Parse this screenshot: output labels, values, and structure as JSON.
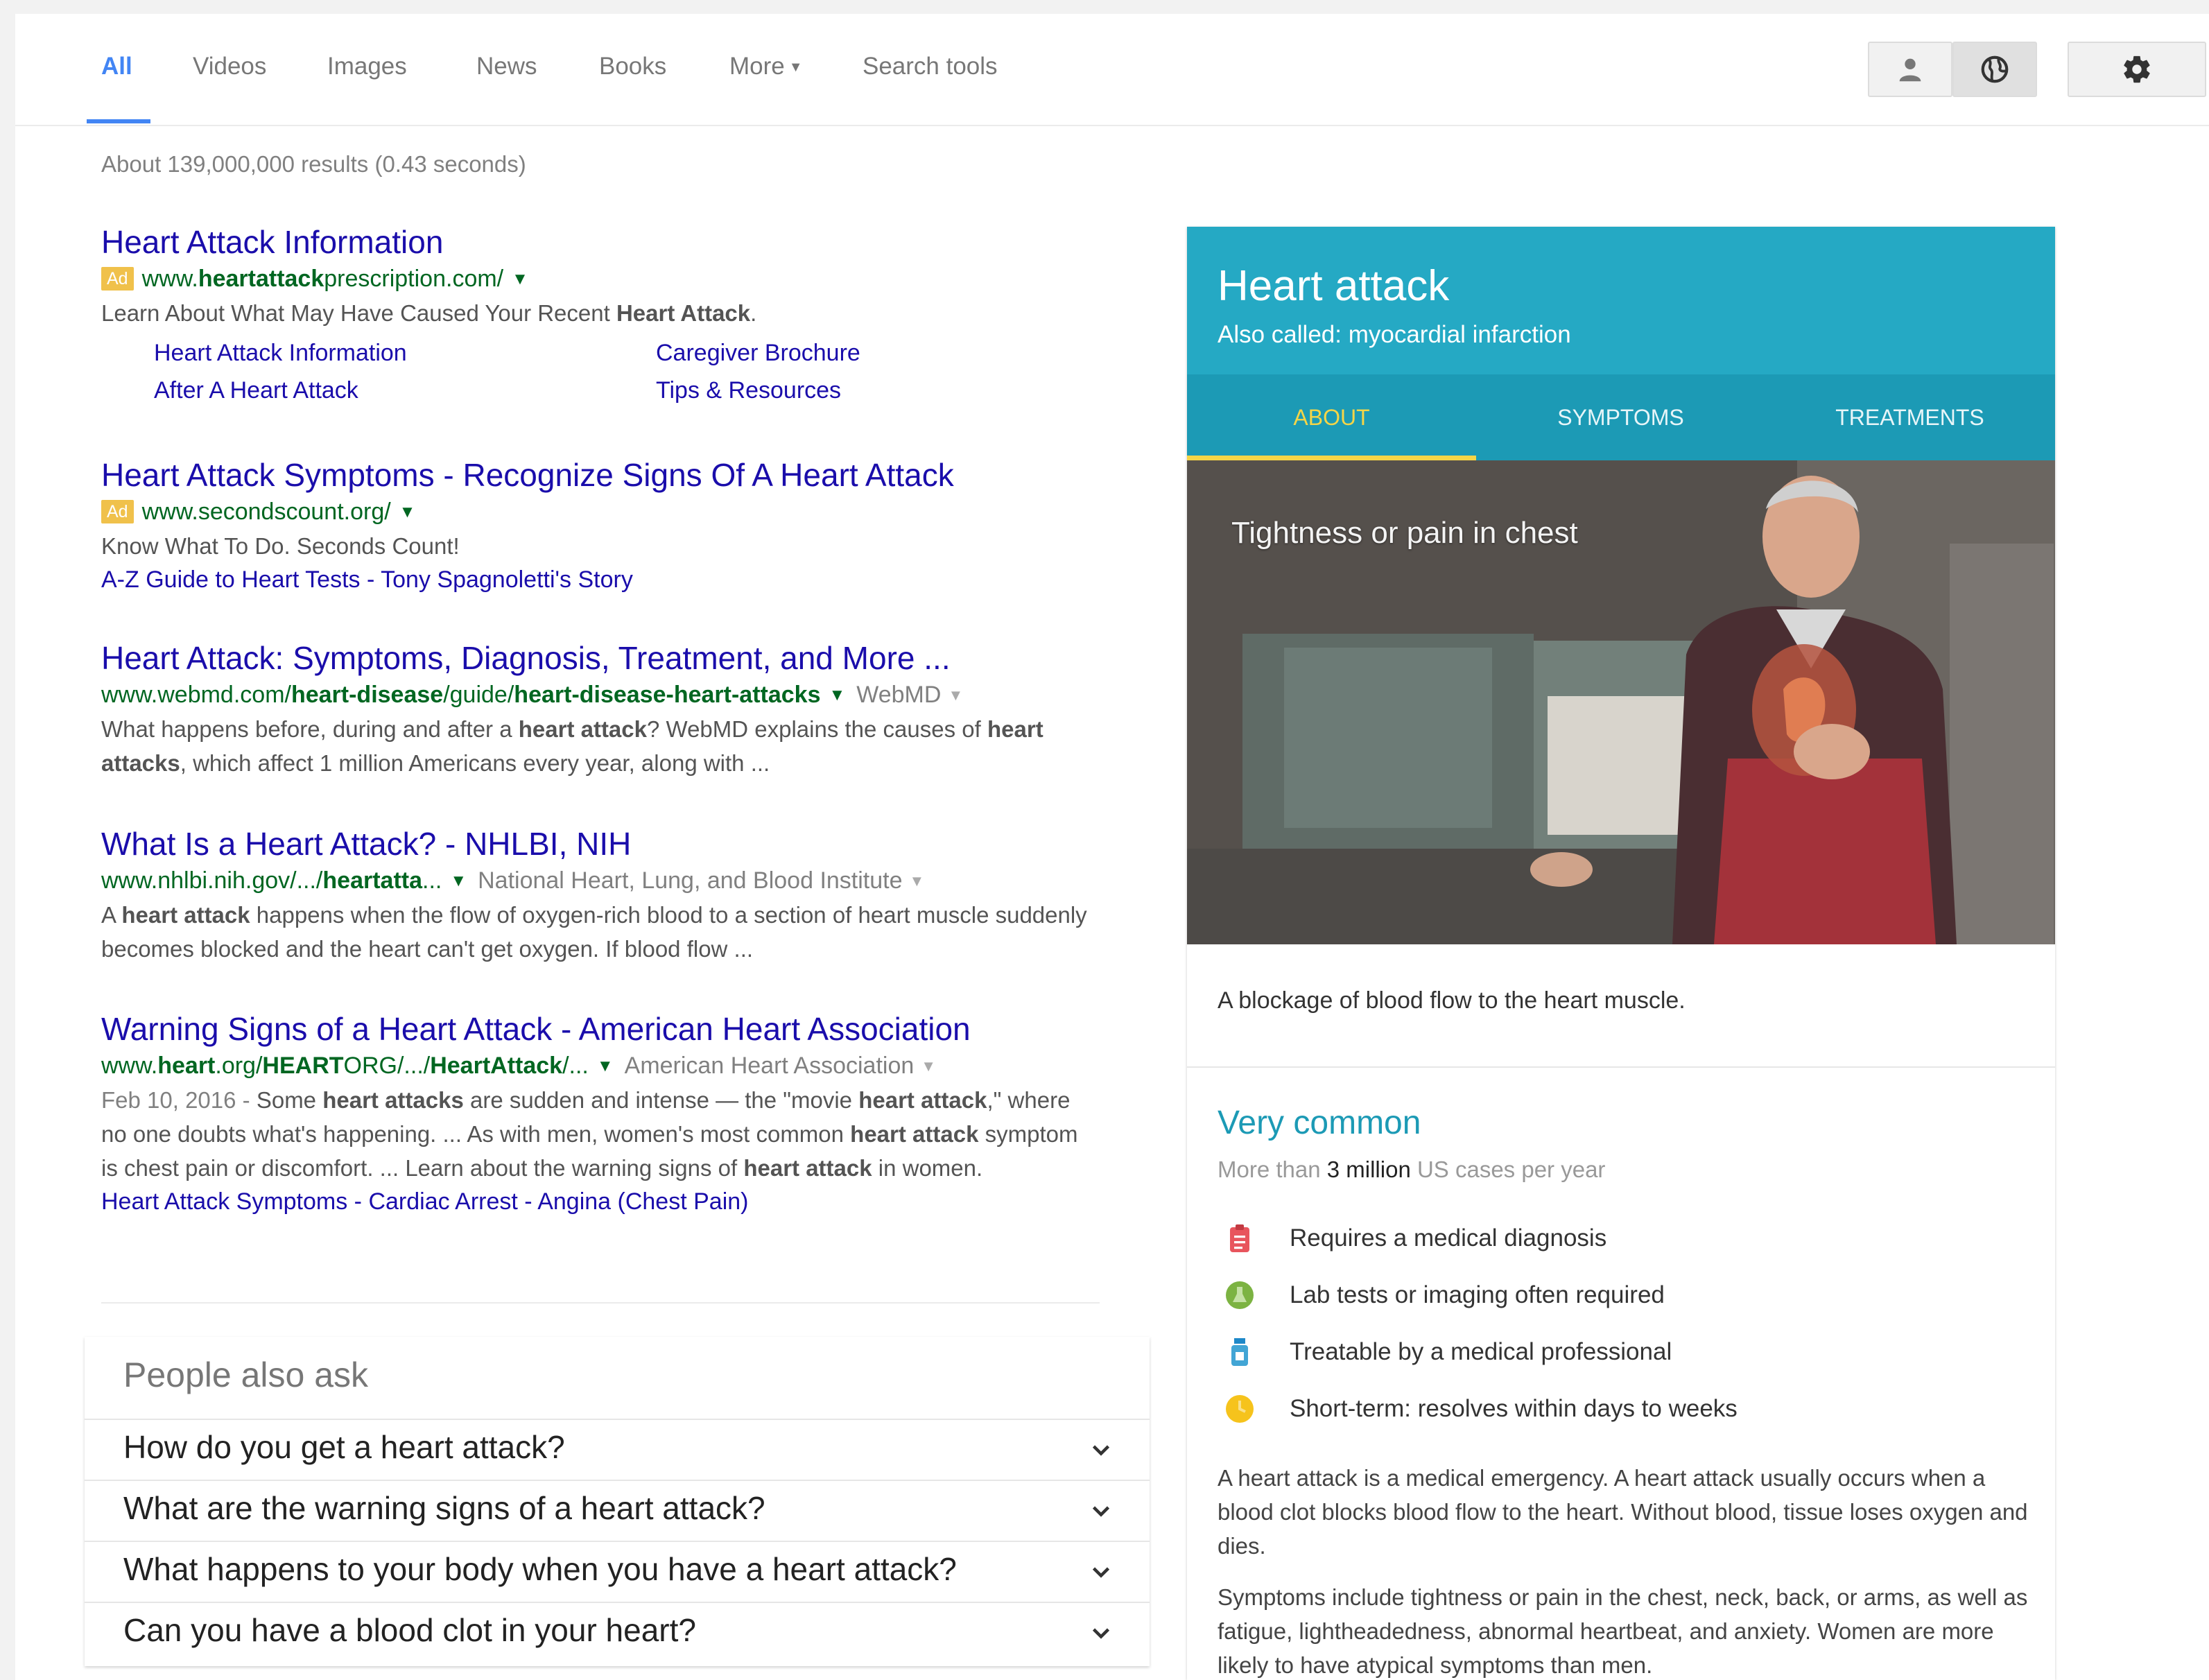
{
  "nav": {
    "tabs": [
      "All",
      "Videos",
      "Images",
      "News",
      "Books",
      "More",
      "Search tools"
    ],
    "active_tab": "All"
  },
  "result_stats": "About 139,000,000 results (0.43 seconds)",
  "results": [
    {
      "title": "Heart Attack Information",
      "ad_label": "Ad",
      "url_pre": "www.",
      "url_bold": "heartattack",
      "url_post": "prescription.com/",
      "snippet_pre": "Learn About What May Have Caused Your Recent ",
      "snippet_bold": "Heart Attack",
      "snippet_post": ".",
      "sitelinks": [
        "Heart Attack Information",
        "After A Heart Attack",
        "Caregiver Brochure",
        "Tips & Resources"
      ]
    },
    {
      "title": "Heart Attack Symptoms - Recognize Signs Of A Heart Attack",
      "ad_label": "Ad",
      "url": "www.secondscount.org/",
      "snippet": "Know What To Do. Seconds Count!",
      "links": [
        "A-Z Guide to Heart Tests",
        "Tony Spagnoletti's Story"
      ]
    },
    {
      "title": "Heart Attack: Symptoms, Diagnosis, Treatment, and More ...",
      "url_parts": [
        "www.webmd.com/",
        "heart-disease",
        "/guide/",
        "heart-disease-heart-attacks"
      ],
      "source": "WebMD",
      "snippet_parts": [
        "What happens before, during and after a ",
        "heart attack",
        "? WebMD explains the causes of ",
        "heart attacks",
        ", which affect 1 million Americans every year, along with ..."
      ]
    },
    {
      "title": "What Is a Heart Attack? - NHLBI, NIH",
      "url_parts": [
        "www.nhlbi.nih.gov/.../",
        "heartatta",
        "..."
      ],
      "source": "National Heart, Lung, and Blood Institute",
      "snippet_parts": [
        "A ",
        "heart attack",
        " happens when the flow of oxygen-rich blood to a section of heart muscle suddenly becomes blocked and the heart can't get oxygen. If blood flow ..."
      ]
    },
    {
      "title": "Warning Signs of a Heart Attack - American Heart Association",
      "url_parts": [
        "www.",
        "heart",
        ".org/",
        "HEART",
        "ORG/.../",
        "HeartAttack",
        "/..."
      ],
      "source": "American Heart Association",
      "date": "Feb 10, 2016 - ",
      "snippet_parts": [
        "Some ",
        "heart attacks",
        " are sudden and intense — the \"movie ",
        "heart attack",
        ",\" where no one doubts what's happening. ... As with men, women's most common ",
        "heart attack",
        " symptom is chest pain or discomfort. ... Learn about the warning signs of ",
        "heart attack",
        " in women."
      ],
      "links": [
        "Heart Attack Symptoms",
        "Cardiac Arrest",
        "Angina (Chest Pain)"
      ]
    }
  ],
  "people_also_ask": {
    "heading": "People also ask",
    "questions": [
      "How do you get a heart attack?",
      "What are the warning signs of a heart attack?",
      "What happens to your body when you have a heart attack?",
      "Can you have a blood clot in your heart?"
    ]
  },
  "knowledge_panel": {
    "title": "Heart attack",
    "subtitle": "Also called: myocardial infarction",
    "tabs": [
      "ABOUT",
      "SYMPTOMS",
      "TREATMENTS"
    ],
    "active_tab": "ABOUT",
    "image_caption": "Tightness or pain in chest",
    "description": "A blockage of blood flow to the heart muscle.",
    "frequency": "Very common",
    "prevalence_pre": "More than ",
    "prevalence_bold": "3 million",
    "prevalence_post": " US cases per year",
    "facts": [
      {
        "icon": "clipboard-icon",
        "color": "#e8555d",
        "text": "Requires a medical diagnosis"
      },
      {
        "icon": "lab-icon",
        "color": "#7cb342",
        "text": "Lab tests or imaging often required"
      },
      {
        "icon": "medicine-bottle-icon",
        "color": "#42a5d5",
        "text": "Treatable by a medical professional"
      },
      {
        "icon": "clock-icon",
        "color": "#f6c31c",
        "text": "Short-term: resolves within days to weeks"
      }
    ],
    "paragraphs": [
      "A heart attack is a medical emergency. A heart attack usually occurs when a blood clot blocks blood flow to the heart. Without blood, tissue loses oxygen and dies.",
      "Symptoms include tightness or pain in the chest, neck, back, or arms, as well as fatigue, lightheadedness, abnormal heartbeat, and anxiety. Women are more likely to have atypical symptoms than men."
    ]
  },
  "colors": {
    "link": "#1a0dab",
    "url_green": "#006621",
    "accent_blue": "#4285f4",
    "kp_header": "#25a9c4",
    "kp_tabs": "#1c9ab5",
    "kp_active": "#f5d547",
    "ad_badge": "#f0c14b"
  }
}
